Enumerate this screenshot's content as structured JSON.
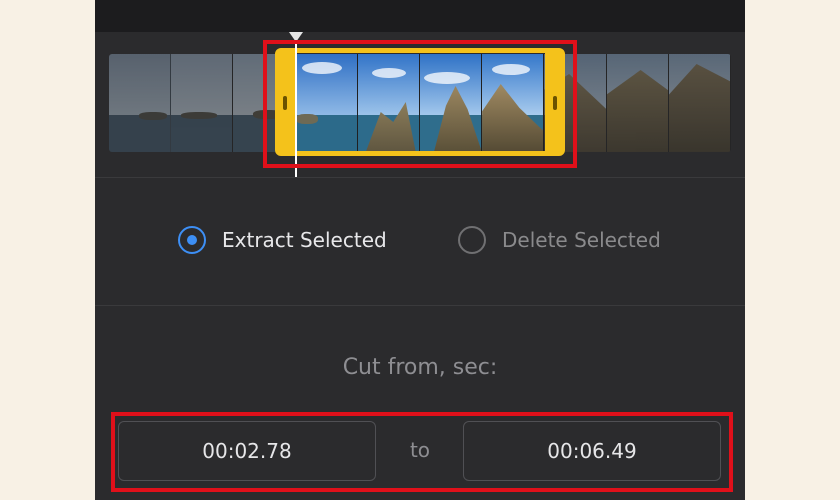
{
  "trim": {
    "options": [
      {
        "label": "Extract Selected",
        "selected": true
      },
      {
        "label": "Delete Selected",
        "selected": false
      }
    ],
    "cut_label": "Cut from, sec:",
    "start_time": "00:02.78",
    "to_label": "to",
    "end_time": "00:06.49"
  },
  "colors": {
    "selection_handle": "#f4c21b",
    "radio_active": "#3d8ff5",
    "highlight_box": "#e0101a",
    "panel_background": "#2b2b2d"
  }
}
